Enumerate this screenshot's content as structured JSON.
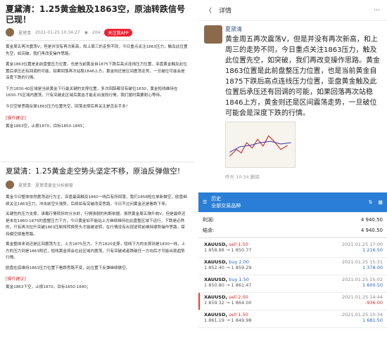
{
  "left_top": {
    "title": "夏黛清：1.25黄金触及1863空，原油转跌信号已现！",
    "author": "夏黛清",
    "date": "2021-01-25 10:34:27",
    "views": "204",
    "follow_label": "关注我APP",
    "para1": "黄金周五再次震荡V，但是并没有再次新高，和上周三的走势不同，今日重点关注1863压力，触及此位置先空，如突破，我们再改变操作思路。",
    "para2": "黄金1863位置是此前盘整压力位置，也是当前黄金自1875下跌后高点连线压力位置，亚盘黄金触及此位置后承压还有回调的可能，如果回落再次站稳1846上方，黄金则还是区间震荡走势，一旦破位可能会是深度下跌的行情。",
    "para3": "下方1830-40区域是当前黄金下行最关键的支撑位置，多次回踩都没有破位1830，黄金短线维持在1830-75区域内震荡，只有突破此区域后黄金才能走出波段行情，我们届时需要耐心等待。",
    "para4": "今日空单思路反弹1863压力位置先空，回落支撑后再关注是否反手多！",
    "op_label": "[操作建议]",
    "op_text": "黄金1863空，止损1870，目标1850-1845；"
  },
  "left_bottom": {
    "title": "夏黛清：1.25黄金走空势头坚定不移，原油反弹做空!",
    "author": "夏黛清",
    "subtitle": "夏黛清黄金分析解套",
    "para1": "黄金今日整体依然震荡运行为主，亚盘最高触及1860一线后有所回落，我们1858短位单新做空，欧盘继续关注1863压力，冲击前空头强势，后续如有突破改变思路，今日不过问黄金还是看跌下来。",
    "para2": "关键性的压力支撑，承载行情转折的分水岭，行情强弱的判断依据。虽然黄金周五弹升收V，但是最终还是未在1860-1875的盘整压力下方，今日黄金如不能站上方继续维持在此盘整区域下运行，下跌是必然的，只有再次拉升突破1863压制将转换势头才能被逆转，在行情没有出现逆转前维持顺势操作思路，保持偏空观看思路。",
    "para3": "黄金整体来说还是区间震荡为主，上方1875压力，下方1820支撑，短线下方的支撑到是1830一线，上方的压力到是1863附近，短线黄金将会在此区域内震荡，只有突破或者跌破任一方向后才可能出现趋势行情。",
    "para4": "欧盘在底维持1863压力位置下看跌思路不变，此位置下反弹继续做空。",
    "op_label": "[操作建议]",
    "op_text": "黄金1863下空，止损1870，目标1850-1840；"
  },
  "right_top": {
    "back_label": "〈",
    "header": "详情",
    "author": "夏黛清",
    "content": "黄金周五再次震荡V，但是并没有再次新高，和上周三的走势不同，今日重点关注1863压力，触及此位置先空，如突破，我们再改变操作思路。黄金1863位置是此前盘整压力位置，也是当前黄金自1875下跌后高点连线压力位置，亚盘黄金触及此位置后承压还有回调的可能，如果回落再次站稳1846上方，黄金则还是区间震荡走势，一旦破位可能会是深度下跌的行情。",
    "footer": "昨天 10:34  删除"
  },
  "right_bottom": {
    "topbar_title": "历史",
    "topbar_sub": "全部交易品种",
    "profit_label": "利润:",
    "profit_value": "4 940.50",
    "balance_label": "结余:",
    "balance_value": "4 940.50",
    "trades": [
      {
        "symbol": "XAUUSD,",
        "side": "sell 1.50",
        "side_color": "red",
        "time": "2021.01.25 17:00",
        "prices": "1 858.88 → 1 850.77",
        "pnl": "1 216.50",
        "pnl_color": "blue",
        "flag": false
      },
      {
        "symbol": "XAUUSD,",
        "side": "buy 2.00",
        "side_color": "blue",
        "time": "2021.01.25 15:31",
        "prices": "1 852.40 → 1 859.29",
        "pnl": "1 378.00",
        "pnl_color": "blue",
        "flag": false
      },
      {
        "symbol": "XAUUSD,",
        "side": "buy 1.50",
        "side_color": "blue",
        "time": "2021.01.25 15:02",
        "prices": "1 850.80 → 1 861.47",
        "pnl": "1 600.50",
        "pnl_color": "blue",
        "flag": false
      },
      {
        "symbol": "XAUUSD,",
        "side": "sell 2.00",
        "side_color": "red",
        "time": "2021.01.25 14:44",
        "prices": "1 859.32 → 1 864.00",
        "pnl": "-936.00",
        "pnl_color": "red",
        "flag": true
      },
      {
        "symbol": "XAUUSD,",
        "side": "sell 1.50",
        "side_color": "red",
        "time": "2021.01.25 10:34",
        "prices": "1 861.19 → 1 849.98",
        "pnl": "1 681.50",
        "pnl_color": "blue",
        "flag": false
      }
    ]
  },
  "colors": {
    "accent_blue": "#2a7ed6",
    "accent_red": "#d42a2a",
    "green_header": "#2e7d32"
  }
}
